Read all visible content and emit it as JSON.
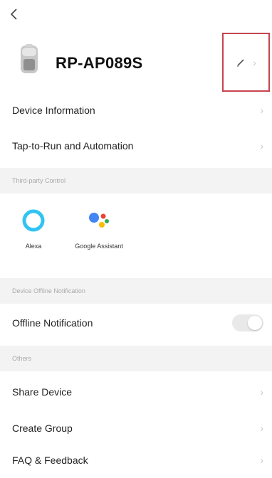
{
  "device": {
    "name": "RP-AP089S"
  },
  "rows": {
    "device_information": "Device Information",
    "tap_to_run": "Tap-to-Run and Automation",
    "offline_notification": "Offline Notification",
    "share_device": "Share Device",
    "create_group": "Create Group",
    "faq": "FAQ & Feedback"
  },
  "sections": {
    "third_party": "Third-party Control",
    "offline": "Device Offline Notification",
    "others": "Others"
  },
  "services": {
    "alexa": "Alexa",
    "google": "Google Assistant"
  },
  "toggles": {
    "offline_notification": false
  },
  "colors": {
    "highlight_box": "#c8444f",
    "alexa": "#31c4f3"
  }
}
